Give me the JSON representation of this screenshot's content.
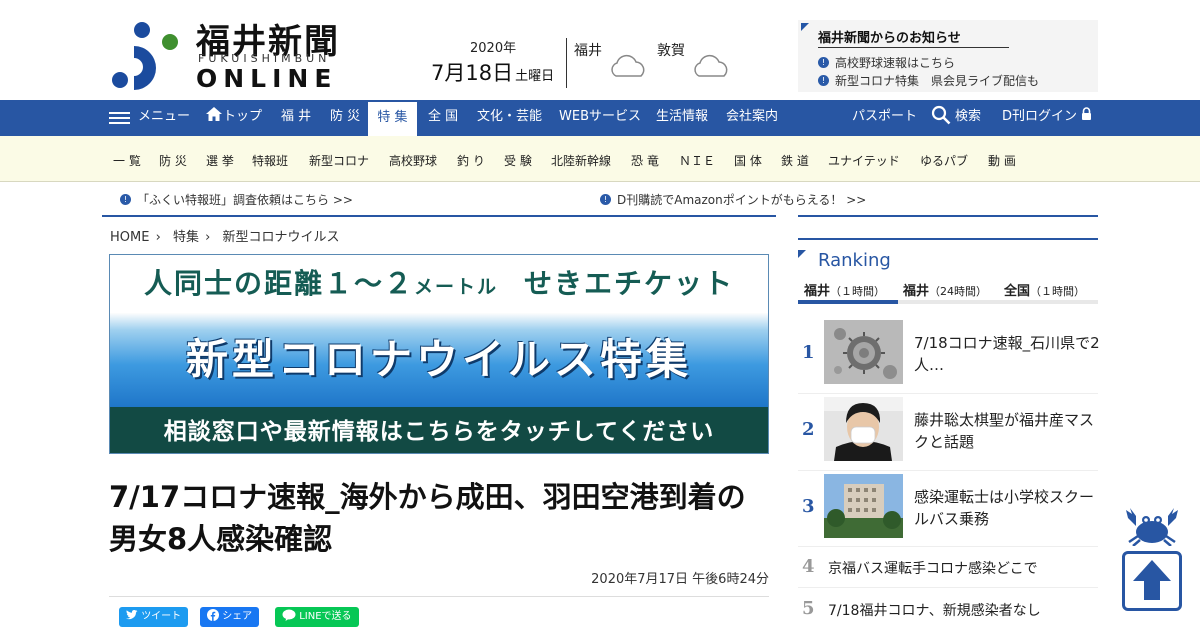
{
  "header": {
    "logo_title": "福井新聞",
    "logo_sub": "FUKUISHIMBUN",
    "logo_online": "ONLINE",
    "date_year": "2020年",
    "date_main": "7月18日",
    "date_day": "土曜日",
    "weather": [
      {
        "city": "福井",
        "icon": "cloud-icon"
      },
      {
        "city": "敦賀",
        "icon": "cloud-icon"
      }
    ],
    "notice_title": "福井新聞からのお知らせ",
    "notice_items": [
      "高校野球速報はこちら",
      "新型コロナ特集　県会見ライブ配信も"
    ]
  },
  "nav": {
    "menu": "メニュー",
    "top": "トップ",
    "items": [
      "福 井",
      "防 災",
      "特 集",
      "全 国",
      "文化・芸能",
      "WEBサービス",
      "生活情報",
      "会社案内"
    ],
    "active": "特 集",
    "passport": "パスポート",
    "search": "検索",
    "login": "D刊ログイン"
  },
  "subnav": [
    "一 覧",
    "防 災",
    "選 挙",
    "特報班",
    "新型コロナ",
    "高校野球",
    "釣 り",
    "受 験",
    "北陸新幹線",
    "恐 竜",
    "ＮＩＥ",
    "国 体",
    "鉄 道",
    "ユナイテッド",
    "ゆるパブ",
    "動 画"
  ],
  "info_links": [
    "「ふくい特報班」調査依頼はこちら >>",
    "D刊購読でAmazonポイントがもらえる！ >>"
  ],
  "breadcrumb": [
    "HOME",
    "特集",
    "新型コロナウイルス"
  ],
  "banner": {
    "top_a": "人同士の距離１～２",
    "top_b": "メートル",
    "top_c": "せきエチケット",
    "middle": "新型コロナウイルス特集",
    "bottom": "相談窓口や最新情報はこちらをタッチしてください"
  },
  "article": {
    "title": "7/17コロナ速報_海外から成田、羽田空港到着の男女8人感染確認",
    "date": "2020年7月17日 午後6時24分",
    "share": [
      "ツイート",
      "シェア",
      "LINEで送る"
    ]
  },
  "ranking": {
    "title": "Ranking",
    "tabs": [
      {
        "name": "福井",
        "sub": "（１時間）"
      },
      {
        "name": "福井",
        "sub": "（24時間）"
      },
      {
        "name": "全国",
        "sub": "（１時間）"
      }
    ],
    "items": [
      {
        "rank": "1",
        "text": "7/18コロナ速報_石川県で2人…"
      },
      {
        "rank": "2",
        "text": "藤井聡太棋聖が福井産マスクと話題"
      },
      {
        "rank": "3",
        "text": "感染運転士は小学校スクールバス乗務"
      },
      {
        "rank": "4",
        "text": "京福バス運転手コロナ感染どこで"
      },
      {
        "rank": "5",
        "text": "7/18福井コロナ、新規感染者なし"
      }
    ]
  },
  "colors": {
    "brand": "#2856a3",
    "subnav_bg": "#fbfbe6",
    "banner_dark": "#124a44"
  }
}
